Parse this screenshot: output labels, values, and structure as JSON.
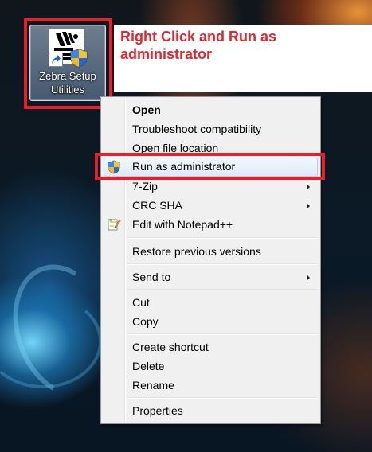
{
  "desktop": {
    "icon_label": "Zebra Setup Utilities"
  },
  "instruction": {
    "text": "Right Click and Run as administrator",
    "color": "#e3262e",
    "box_color": "#e6202a"
  },
  "context_menu": {
    "items": [
      {
        "label": "Open",
        "bold": true,
        "submenu": false
      },
      {
        "label": "Troubleshoot compatibility",
        "submenu": false
      },
      {
        "label": "Open file location",
        "submenu": false
      },
      {
        "label": "Run as administrator",
        "submenu": false,
        "icon": "uac-shield-icon",
        "highlighted": true
      },
      {
        "label": "7-Zip",
        "submenu": true
      },
      {
        "label": "CRC SHA",
        "submenu": true
      },
      {
        "label": "Edit with Notepad++",
        "submenu": false,
        "icon": "notepad-plus-plus-icon"
      },
      {
        "label": "Restore previous versions",
        "submenu": false
      },
      {
        "label": "Send to",
        "submenu": true
      },
      {
        "label": "Cut",
        "submenu": false
      },
      {
        "label": "Copy",
        "submenu": false
      },
      {
        "label": "Create shortcut",
        "submenu": false
      },
      {
        "label": "Delete",
        "submenu": false
      },
      {
        "label": "Rename",
        "submenu": false
      },
      {
        "label": "Properties",
        "submenu": false
      }
    ]
  }
}
